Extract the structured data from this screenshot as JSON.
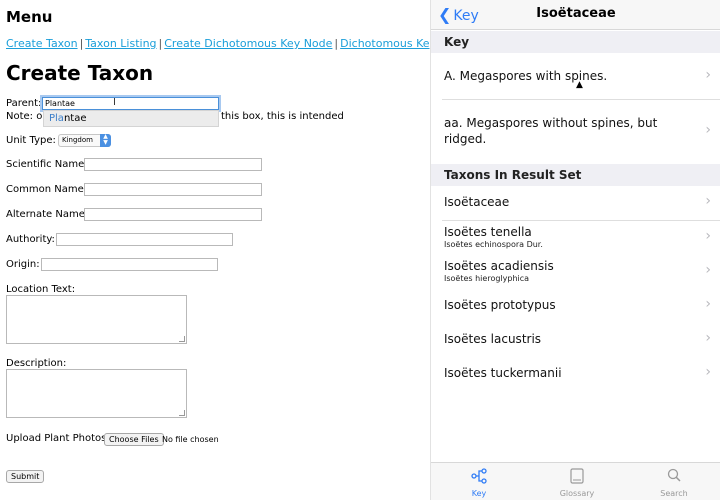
{
  "form": {
    "menu_title": "Menu",
    "nav_links": [
      "Create Taxon",
      "Taxon Listing",
      "Create Dichotomous Key Node",
      "Dichotomous Key Listing"
    ],
    "nav_separator": "|",
    "page_title": "Create Taxon",
    "parent_label": "Parent:",
    "parent_value": "Plantae",
    "note_prefix": "Note: o",
    "note_suffix": "this box, this is intended",
    "autocomplete_match": "Pla",
    "autocomplete_rest": "ntae",
    "unit_type_label": "Unit Type:",
    "unit_type_value": "Kingdom",
    "scientific_name_label": "Scientific Name:",
    "common_name_label": "Common Name:",
    "alternate_name_label": "Alternate Name:",
    "authority_label": "Authority:",
    "origin_label": "Origin:",
    "location_label": "Location Text:",
    "description_label": "Description:",
    "upload_label": "Upload Plant Photos:",
    "choose_files": "Choose Files",
    "no_file": "No file chosen",
    "submit": "Submit"
  },
  "app": {
    "back_label": "Key",
    "title": "Isoëtaceae",
    "key_header": "Key",
    "key_options": [
      {
        "label": "A. Megaspores with spines."
      },
      {
        "label": "aa. Megaspores without spines, but ridged."
      }
    ],
    "results_header": "Taxons In Result Set",
    "taxa": [
      {
        "name": "Isoëtaceae",
        "synonym": ""
      },
      {
        "name": "Isoëtes tenella",
        "synonym": "Isoëtes echinospora Dur."
      },
      {
        "name": "Isoëtes acadiensis",
        "synonym": "Isoëtes hieroglyphica"
      },
      {
        "name": "Isoëtes prototypus",
        "synonym": ""
      },
      {
        "name": "Isoëtes lacustris",
        "synonym": ""
      },
      {
        "name": "Isoëtes tuckermanii",
        "synonym": ""
      }
    ],
    "tabs": [
      {
        "label": "Key",
        "icon": "key-tree-icon"
      },
      {
        "label": "Glossary",
        "icon": "book-icon"
      },
      {
        "label": "Search",
        "icon": "search-icon"
      }
    ],
    "accent_color": "#2f7cf6"
  }
}
